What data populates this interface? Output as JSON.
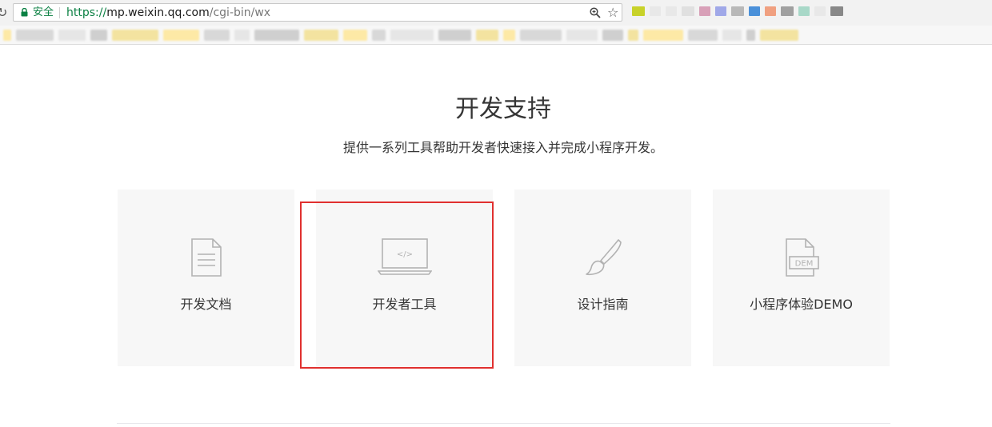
{
  "browser": {
    "security_label": "安全",
    "url_scheme": "https://",
    "url_host": "mp.weixin.qq.com",
    "url_path": "/cgi-bin/wx",
    "extension_colors": [
      "#c8d22a",
      "#e8e8e8",
      "#e8e8e8",
      "#e0e0e0",
      "#d8a0b8",
      "#a0a8e8",
      "#b8b8b8",
      "#4a90d9",
      "#f0a080",
      "#a0a0a0",
      "#a8d8c8",
      "#e8e8e8",
      "#888888"
    ]
  },
  "main": {
    "title": "开发支持",
    "subtitle": "提供一系列工具帮助开发者快速接入并完成小程序开发。",
    "cards": [
      {
        "label": "开发文档",
        "icon": "document-icon"
      },
      {
        "label": "开发者工具",
        "icon": "laptop-code-icon"
      },
      {
        "label": "设计指南",
        "icon": "paintbrush-icon"
      },
      {
        "label": "小程序体验DEMO",
        "icon": "demo-file-icon"
      }
    ]
  },
  "colors": {
    "card_background": "#f7f7f7",
    "icon_stroke": "#b2b2b2",
    "highlight": "#e0302f",
    "secure_green": "#0b8043"
  }
}
